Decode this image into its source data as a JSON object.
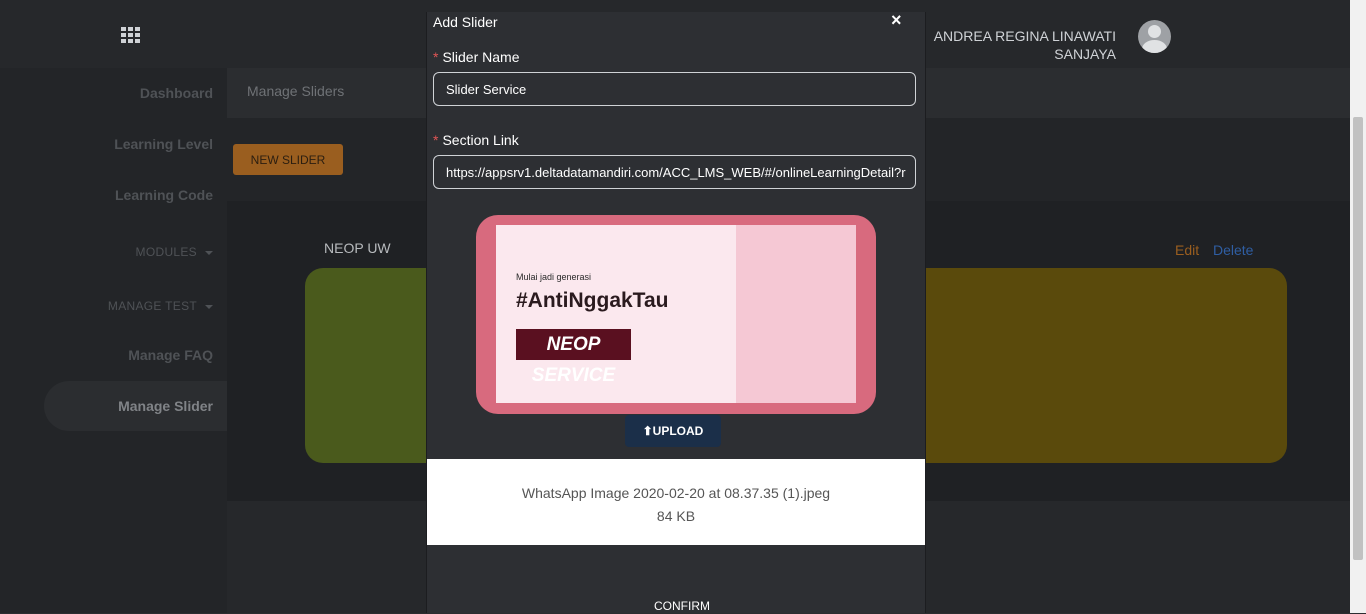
{
  "header": {
    "user_name_line1": "ANDREA REGINA LINAWATI",
    "user_name_line2": "SANJAYA"
  },
  "sidebar": {
    "items": [
      {
        "label": "Dashboard"
      },
      {
        "label": "Learning Level"
      },
      {
        "label": "Learning Code"
      },
      {
        "label": "MODULES"
      },
      {
        "label": "MANAGE TEST"
      },
      {
        "label": "Manage FAQ"
      },
      {
        "label": "Manage Slider"
      }
    ]
  },
  "main": {
    "breadcrumb": "Manage Sliders",
    "new_slider_label": "NEW SLIDER",
    "slider_title": "NEOP UW",
    "edit_label": "Edit",
    "delete_label": "Delete"
  },
  "modal": {
    "title": "Add Slider",
    "close_label": "×",
    "slider_name_label": "Slider Name",
    "slider_name_value": "Slider Service",
    "section_link_label": "Section Link",
    "section_link_value": "https://appsrv1.deltadatamandiri.com/ACC_LMS_WEB/#/onlineLearningDetail?r",
    "required_mark": "*",
    "preview": {
      "small_text": "Mulai jadi generasi",
      "hashtag": "#AntiNggakTau",
      "badge": "NEOP SERVICE"
    },
    "upload_label": "⬆UPLOAD",
    "file_name": "WhatsApp Image 2020-02-20 at 08.37.35 (1).jpeg",
    "file_size": "84 KB",
    "confirm_label": "CONFIRM"
  },
  "colors": {
    "accent_orange": "#9a5e1f",
    "delete_blue": "#2f5ea3",
    "upload_navy": "#1b2f49"
  }
}
